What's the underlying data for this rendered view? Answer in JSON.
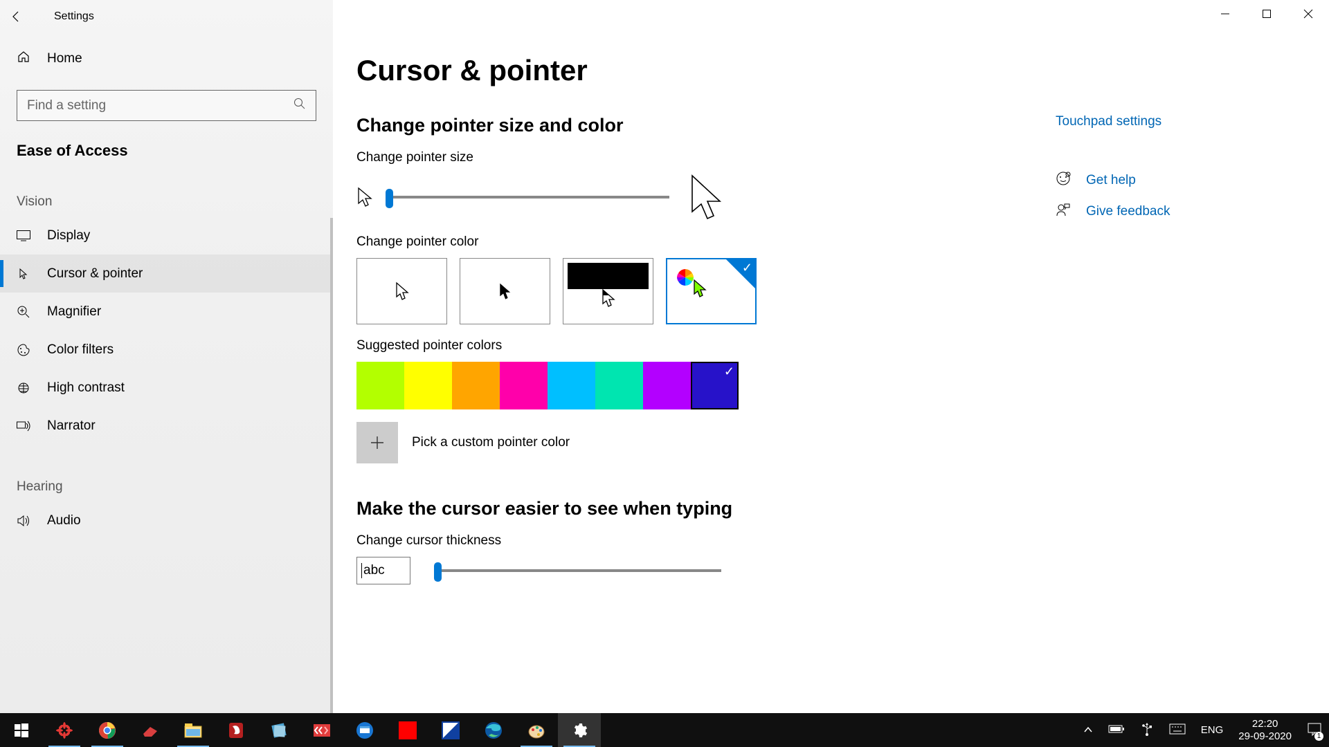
{
  "titlebar": {
    "title": "Settings"
  },
  "sidebar": {
    "home": "Home",
    "search_placeholder": "Find a setting",
    "section": "Ease of Access",
    "group_vision": "Vision",
    "group_hearing": "Hearing",
    "items": {
      "display": "Display",
      "cursor": "Cursor & pointer",
      "magnifier": "Magnifier",
      "color_filters": "Color filters",
      "high_contrast": "High contrast",
      "narrator": "Narrator",
      "audio": "Audio"
    }
  },
  "main": {
    "heading": "Cursor & pointer",
    "section_size_color": "Change pointer size and color",
    "label_size": "Change pointer size",
    "label_color": "Change pointer color",
    "label_suggested": "Suggested pointer colors",
    "custom_color": "Pick a custom pointer color",
    "section_typing": "Make the cursor easier to see when typing",
    "label_thickness": "Change cursor thickness",
    "abc": "abc"
  },
  "colors": {
    "swatches": [
      "#b3ff00",
      "#ffff00",
      "#ffa500",
      "#ff00aa",
      "#00bfff",
      "#00e5b0",
      "#b300ff",
      "#2712c9"
    ],
    "selected_index": 7
  },
  "right": {
    "touchpad": "Touchpad settings",
    "help": "Get help",
    "feedback": "Give feedback"
  },
  "taskbar": {
    "lang": "ENG",
    "time": "22:20",
    "date": "29-09-2020",
    "notif_count": "1"
  }
}
